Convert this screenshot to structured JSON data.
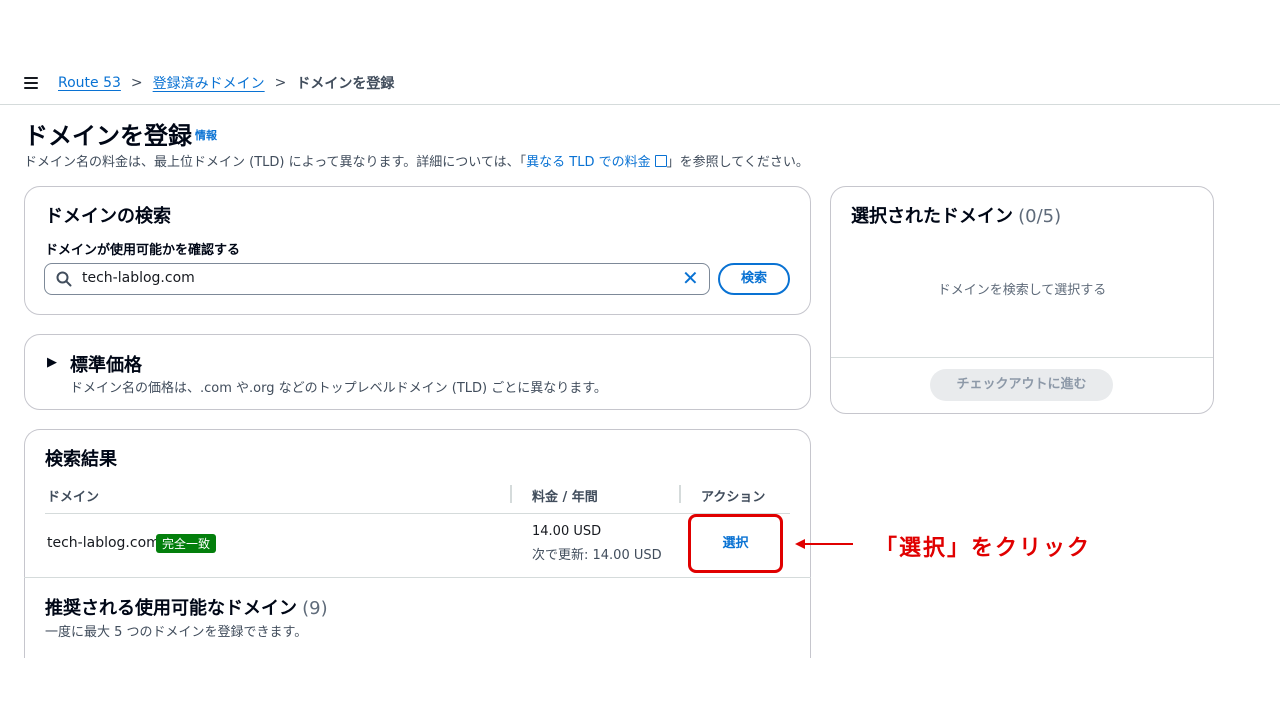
{
  "breadcrumb": {
    "items": [
      "Route 53",
      "登録済みドメイン"
    ],
    "current": "ドメインを登録",
    "separator": ">"
  },
  "page": {
    "title": "ドメインを登録",
    "info_link": "情報",
    "description_before": "ドメイン名の料金は、最上位ドメイン (TLD) によって異なります。詳細については、「",
    "description_link": "異なる TLD での料金",
    "description_after": "」を参照してください。"
  },
  "search_panel": {
    "title": "ドメインの検索",
    "label": "ドメインが使用可能かを確認する",
    "value": "tech-lablog.com",
    "clear_glyph": "✕",
    "button": "検索"
  },
  "pricing_panel": {
    "toggle_glyph": "▶",
    "title": "標準価格",
    "description": "ドメイン名の価格は、.com や.org などのトップレベルドメイン (TLD) ごとに異なります。"
  },
  "results_panel": {
    "title": "検索結果",
    "columns": [
      "ドメイン",
      "料金 / 年間",
      "アクション"
    ],
    "rows": [
      {
        "domain": "tech-lablog.com",
        "badge": "完全一致",
        "price": "14.00 USD",
        "renewal": "次で更新: 14.00 USD",
        "action": "選択"
      }
    ],
    "suggested_title": "推奨される使用可能なドメイン",
    "suggested_count": "(9)",
    "suggested_note": "一度に最大 5 つのドメインを登録できます。"
  },
  "selected_panel": {
    "title": "選択されたドメイン",
    "count": "(0/5)",
    "empty_text": "ドメインを検索して選択する",
    "checkout_button": "チェックアウトに進む"
  },
  "annotation": {
    "text": "「選択」をクリック",
    "color": "#e00000"
  },
  "colors": {
    "link": "#0972d3",
    "badge_green": "#037f0c",
    "highlight_red": "#e00000"
  }
}
